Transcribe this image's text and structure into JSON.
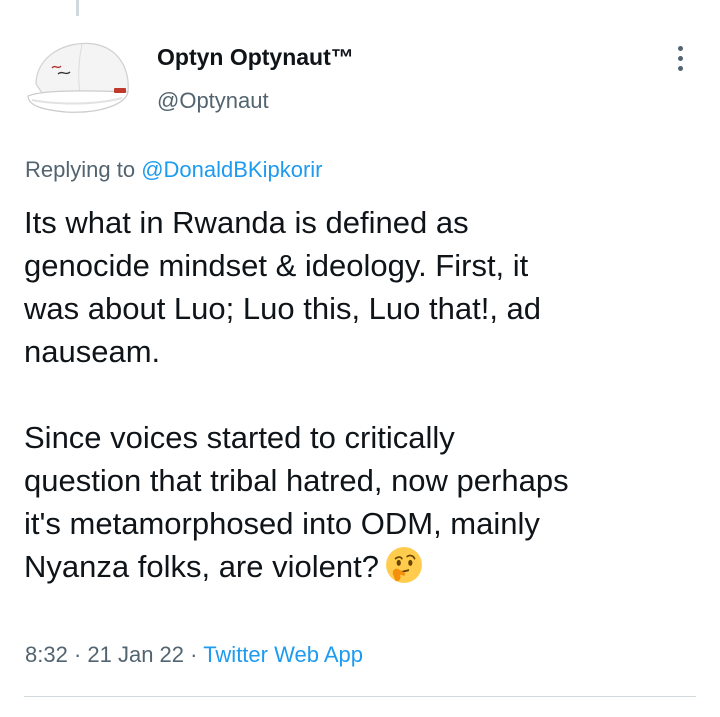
{
  "tweet": {
    "display_name": "Optyn Optynaut™",
    "handle": "@Optynaut",
    "replying_prefix": "Replying to ",
    "replying_to": "@DonaldBKipkorir",
    "text": "Its what in Rwanda is defined as\ngenocide mindset & ideology. First, it\nwas about Luo; Luo this, Luo that!, ad\nnauseam.\n\nSince voices started to critically\nquestion that tribal hatred, now perhaps\nit's metamorphosed into ODM, mainly\nNyanza folks, are violent?",
    "emoji": "thinking-face-emoji",
    "time": "8:32",
    "date": "21 Jan 22",
    "separator": " · ",
    "source": "Twitter Web App"
  },
  "icons": {
    "avatar": "white-cap-avatar",
    "more": "more-options-icon"
  },
  "colors": {
    "accent": "#1d9bf0",
    "secondary_text": "#536471",
    "primary_text": "#0f1419",
    "divider": "#cfd9de"
  }
}
